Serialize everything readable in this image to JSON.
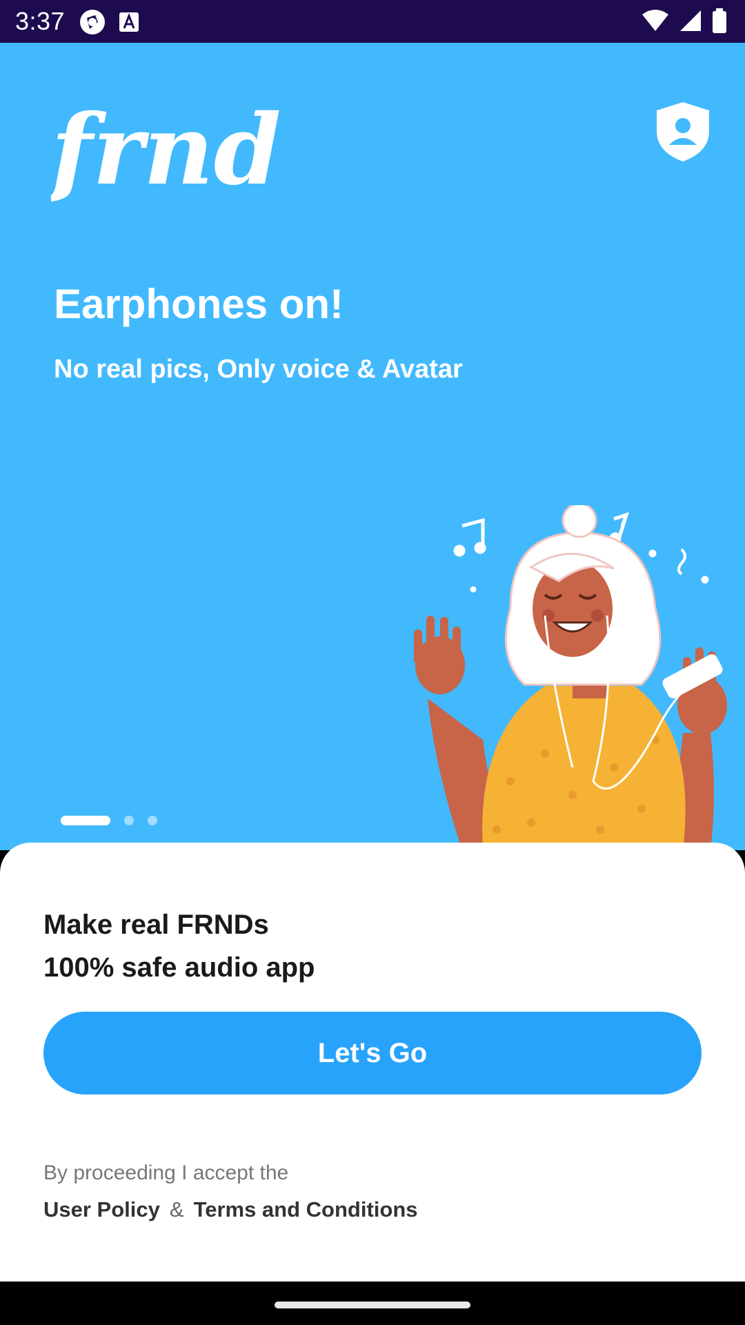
{
  "status_bar": {
    "time": "3:37",
    "left_icons": [
      "app-notification-icon",
      "text-a-icon"
    ],
    "right_icons": [
      "wifi-icon",
      "signal-icon",
      "battery-icon"
    ]
  },
  "hero": {
    "logo_text": "frnd",
    "title": "Earphones on!",
    "subtitle": "No real pics, Only voice & Avatar",
    "pager": {
      "count": 3,
      "active_index": 0
    },
    "background_color": "#42b9fd"
  },
  "sheet": {
    "title_line1": "Make real FRNDs",
    "title_line2": "100% safe audio app",
    "cta_label": "Let's Go",
    "legal_text": "By proceeding I accept the",
    "user_policy_label": "User Policy",
    "ampersand": "&",
    "terms_label": "Terms and Conditions",
    "cta_color": "#28a3fb"
  }
}
